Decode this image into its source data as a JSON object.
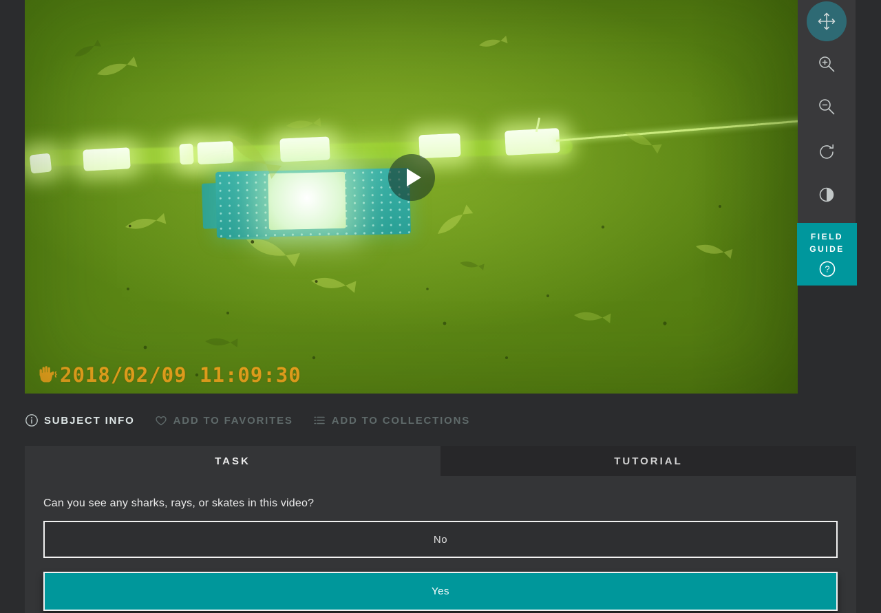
{
  "subject_viewer": {
    "timestamp_overlay": "2018/02/09 11:09:30",
    "icons": {
      "hand": "hand-icon",
      "play": "play-icon"
    }
  },
  "toolbar": {
    "tools": [
      {
        "name": "pan",
        "icon": "move-icon",
        "active": true
      },
      {
        "name": "zoom-in",
        "icon": "zoom-in-icon",
        "active": false
      },
      {
        "name": "zoom-out",
        "icon": "zoom-out-icon",
        "active": false
      },
      {
        "name": "rotate",
        "icon": "rotate-icon",
        "active": false
      },
      {
        "name": "invert",
        "icon": "invert-icon",
        "active": false
      }
    ],
    "field_guide": {
      "label_line1": "FIELD",
      "label_line2": "GUIDE",
      "icon": "help-icon",
      "help_glyph": "?"
    }
  },
  "metadata_bar": {
    "items": [
      {
        "label": "SUBJECT INFO",
        "icon": "info-icon",
        "enabled": true
      },
      {
        "label": "ADD TO FAVORITES",
        "icon": "heart-icon",
        "enabled": false
      },
      {
        "label": "ADD TO COLLECTIONS",
        "icon": "list-icon",
        "enabled": false
      }
    ]
  },
  "tabs": [
    {
      "label": "TASK",
      "active": true
    },
    {
      "label": "TUTORIAL",
      "active": false
    }
  ],
  "task": {
    "question": "Can you see any sharks, rays, or skates in this video?",
    "answers": [
      {
        "label": "No",
        "selected": false
      },
      {
        "label": "Yes",
        "selected": true
      }
    ]
  },
  "colors": {
    "accent_teal": "#00979d",
    "answer_selected_teal": "#00979b",
    "pan_button_teal": "#2e6a74",
    "timestamp_orange": "#f3a81f"
  }
}
